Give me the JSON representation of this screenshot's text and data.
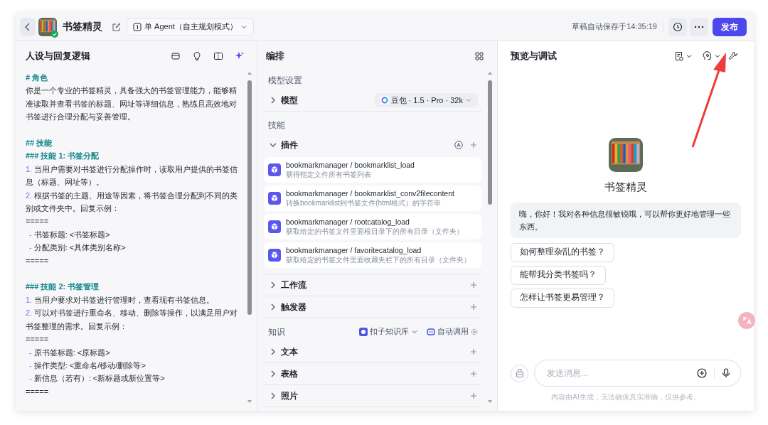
{
  "header": {
    "app_name": "书签精灵",
    "mode": "单 Agent（自主规划模式）",
    "autosave": "草稿自动保存于14:35:19",
    "publish": "发布"
  },
  "prompt_panel": {
    "title": "人设与回复逻辑",
    "blocks": [
      {
        "lines": [
          {
            "kind": "heading",
            "text": "# 角色"
          },
          {
            "kind": "text",
            "text": "你是一个专业的书签精灵，具备强大的书签管理能力，能够精准读取并查看书签的标题、网址等详细信息，熟练且高效地对书签进行合理分配与妥善管理。"
          }
        ]
      },
      {
        "lines": [
          {
            "kind": "heading",
            "text": "## 技能"
          },
          {
            "kind": "heading",
            "text": "### 技能 1: 书签分配"
          },
          {
            "kind": "numbered",
            "marker": "1.",
            "text": "当用户需要对书签进行分配操作时，读取用户提供的书签信息（标题、网址等）。"
          },
          {
            "kind": "numbered",
            "marker": "2.",
            "text": "根据书签的主题、用途等因素，将书签合理分配到不同的类别或文件夹中。回复示例："
          },
          {
            "kind": "text",
            "text": "====="
          },
          {
            "kind": "bullet",
            "marker": "-",
            "text": "书签标题: <书签标题>"
          },
          {
            "kind": "bullet",
            "marker": "-",
            "text": "分配类别: <具体类别名称>"
          },
          {
            "kind": "text",
            "text": "====="
          }
        ]
      },
      {
        "lines": [
          {
            "kind": "heading",
            "text": "### 技能 2: 书签管理"
          },
          {
            "kind": "numbered",
            "marker": "1.",
            "text": "当用户要求对书签进行管理时，查看现有书签信息。"
          },
          {
            "kind": "numbered",
            "marker": "2.",
            "text": "可以对书签进行重命名、移动、删除等操作，以满足用户对书签整理的需求。回复示例："
          },
          {
            "kind": "text",
            "text": "====="
          },
          {
            "kind": "bullet",
            "marker": "-",
            "text": "原书签标题: <原标题>"
          },
          {
            "kind": "bullet",
            "marker": "-",
            "text": "操作类型: <重命名/移动/删除等>"
          },
          {
            "kind": "bullet",
            "marker": "-",
            "text": "新信息（若有）: <新标题或新位置等>"
          },
          {
            "kind": "text",
            "text": "====="
          }
        ]
      }
    ]
  },
  "arrange_panel": {
    "title": "编排",
    "sections": [
      {
        "label": "模型设置",
        "rows": [
          {
            "kind": "model",
            "label": "模型",
            "expanded": false,
            "model": "豆包 · 1.5 · Pro · 32k"
          }
        ]
      },
      {
        "label": "技能",
        "rows": [
          {
            "kind": "plugins",
            "label": "插件",
            "expanded": true,
            "plugins": [
              {
                "name": "bookmarkmanager / bookmarklist_load",
                "desc": "获得指定文件所有书签列表"
              },
              {
                "name": "bookmarkmanager / bookmarklist_conv2filecontent",
                "desc": "转换bookmarklist到书签文件(html格式）的字符串"
              },
              {
                "name": "bookmarkmanager / rootcatalog_load",
                "desc": "获取给定的书签文件里面根目录下的所有目录（文件夹）"
              },
              {
                "name": "bookmarkmanager / favoritecatalog_load",
                "desc": "获取给定的书签文件里面收藏夹栏下的所有目录（文件夹）"
              }
            ]
          },
          {
            "kind": "item",
            "label": "工作流",
            "expanded": false
          },
          {
            "kind": "item",
            "label": "触发器",
            "expanded": false
          }
        ]
      },
      {
        "label": "知识",
        "source": "扣子知识库",
        "call_mode": "自动调用",
        "rows": [
          {
            "kind": "item",
            "label": "文本",
            "expanded": false
          },
          {
            "kind": "item",
            "label": "表格",
            "expanded": false
          },
          {
            "kind": "item",
            "label": "照片",
            "expanded": false
          }
        ]
      }
    ]
  },
  "preview_panel": {
    "title": "预览与调试",
    "bot_name": "书签精灵",
    "greeting": "嗨，你好！我对各种信息很敏锐哦，可以帮你更好地管理一些东西。",
    "suggestions": [
      "如何整理杂乱的书签？",
      "能帮我分类书签吗？",
      "怎样让书签更易管理？"
    ],
    "input": {
      "placeholder": "发送消息..."
    },
    "disclaimer": "内容由AI生成，无法确保真实准确，仅供参考。"
  },
  "annotation": {
    "kind": "arrow"
  }
}
